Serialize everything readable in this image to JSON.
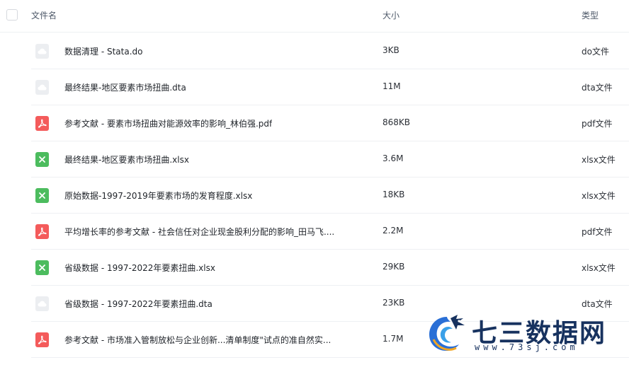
{
  "header": {
    "name": "文件名",
    "size": "大小",
    "type": "类型"
  },
  "files": [
    {
      "icon": "generic",
      "name": "数据清理 - Stata.do",
      "size": "3KB",
      "type": "do文件"
    },
    {
      "icon": "generic",
      "name": "最终结果-地区要素市场扭曲.dta",
      "size": "11M",
      "type": "dta文件"
    },
    {
      "icon": "pdf",
      "name": "参考文献 - 要素市场扭曲对能源效率的影响_林伯强.pdf",
      "size": "868KB",
      "type": "pdf文件"
    },
    {
      "icon": "xlsx",
      "name": "最终结果-地区要素市场扭曲.xlsx",
      "size": "3.6M",
      "type": "xlsx文件"
    },
    {
      "icon": "xlsx",
      "name": "原始数据-1997-2019年要素市场的发育程度.xlsx",
      "size": "18KB",
      "type": "xlsx文件"
    },
    {
      "icon": "pdf",
      "name": "平均增长率的参考文献 - 社会信任对企业现金股利分配的影响_田马飞....",
      "size": "2.2M",
      "type": "pdf文件"
    },
    {
      "icon": "xlsx",
      "name": "省级数据 - 1997-2022年要素扭曲.xlsx",
      "size": "29KB",
      "type": "xlsx文件"
    },
    {
      "icon": "generic",
      "name": "省级数据 - 1997-2022年要素扭曲.dta",
      "size": "23KB",
      "type": "dta文件"
    },
    {
      "icon": "pdf",
      "name": "参考文献 - 市场准入管制放松与企业创新...清单制度\"试点的准自然实...",
      "size": "1.7M",
      "type": ""
    }
  ],
  "watermark": {
    "title": "七三数据网",
    "url": "www.73sj.com"
  },
  "colors": {
    "pdf": "#f45b5b",
    "xlsx": "#4cbc5e",
    "generic": "#eceef1"
  }
}
